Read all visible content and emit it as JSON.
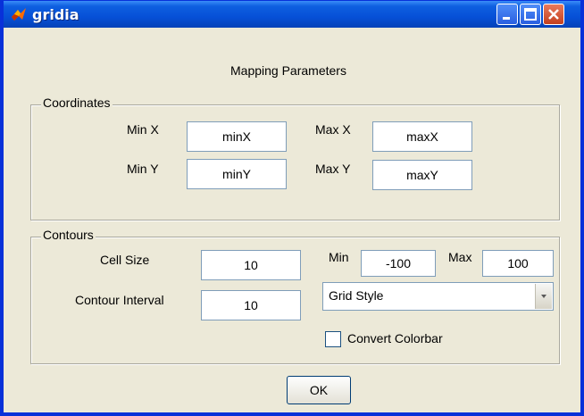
{
  "window": {
    "title": "gridia"
  },
  "header": {
    "title": "Mapping Parameters"
  },
  "coordinates": {
    "title": "Coordinates",
    "min_x_label": "Min X",
    "min_x_value": "minX",
    "max_x_label": "Max X",
    "max_x_value": "maxX",
    "min_y_label": "Min Y",
    "min_y_value": "minY",
    "max_y_label": "Max Y",
    "max_y_value": "maxY"
  },
  "contours": {
    "title": "Contours",
    "cell_size_label": "Cell Size",
    "cell_size_value": "10",
    "contour_interval_label": "Contour Interval",
    "contour_interval_value": "10",
    "min_label": "Min",
    "min_value": "-100",
    "max_label": "Max",
    "max_value": "100",
    "grid_style_value": "Grid Style",
    "convert_colorbar_label": "Convert Colorbar",
    "convert_colorbar_checked": false
  },
  "footer": {
    "ok_label": "OK"
  },
  "colors": {
    "titlebar": "#0650d7",
    "dialog_bg": "#ece9d8",
    "close_button": "#c4401e"
  },
  "icons": {
    "app": "matlab-icon",
    "minimize": "minimize-icon",
    "maximize": "maximize-icon",
    "close": "close-icon"
  }
}
